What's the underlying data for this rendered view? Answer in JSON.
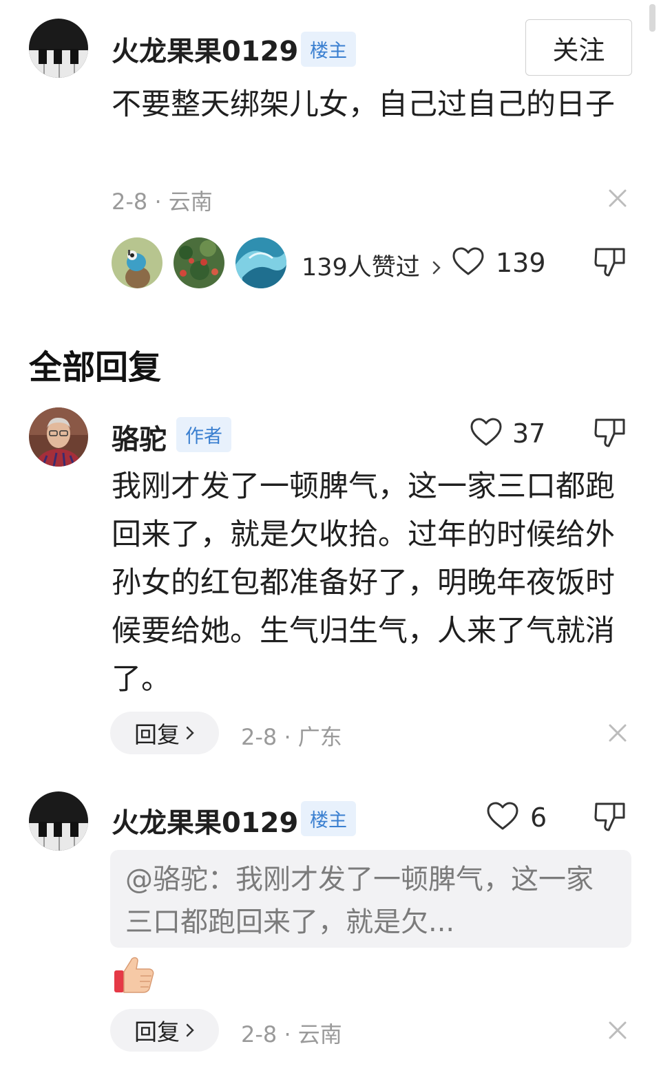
{
  "post": {
    "author": "火龙果果0129",
    "author_tag": "楼主",
    "follow_label": "关注",
    "content": "不要整天绑架儿女，自己过自己的日子",
    "date": "2-8",
    "location": "云南",
    "likers_label": "139人赞过",
    "like_count": "139"
  },
  "section_title": "全部回复",
  "replies": [
    {
      "author": "骆驼",
      "author_tag": "作者",
      "like_count": "37",
      "content": "我刚才发了一顿脾气，这一家三口都跑回来了，就是欠收拾。过年的时候给外孙女的红包都准备好了，明晚年夜饭时候要给她。生气归生气，人来了气就消了。",
      "reply_label": "回复",
      "date": "2-8",
      "location": "广东"
    },
    {
      "author": "火龙果果0129",
      "author_tag": "楼主",
      "like_count": "6",
      "quote": "@骆驼：我刚才发了一顿脾气，这一家三口都跑回来了，就是欠...",
      "reply_label": "回复",
      "date": "2-8",
      "location": "云南"
    }
  ],
  "icons": {
    "heart": "heart-outline",
    "dislike": "thumbs-down-outline",
    "close": "close-x",
    "chevron": "chevron-right",
    "emoji": "thumbs-up-emoji"
  },
  "colors": {
    "tag_text": "#3a7fd0",
    "tag_bg": "#e8f1fc",
    "meta_text": "#9a9a9a",
    "chip_bg": "#f2f2f4"
  }
}
